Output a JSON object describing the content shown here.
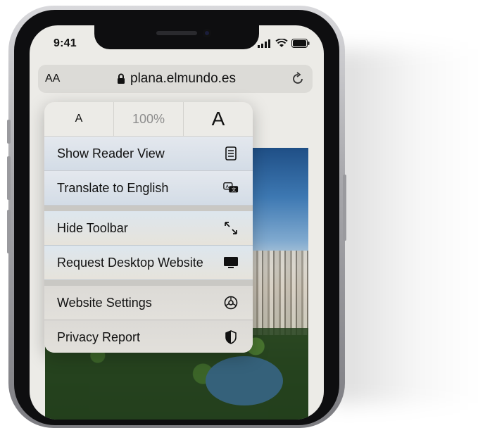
{
  "status_bar": {
    "time": "9:41"
  },
  "address_bar": {
    "text_size_icon": "AA",
    "lock_icon": "lock-icon",
    "url": "plana.elmundo.es",
    "reload_icon": "reload-icon"
  },
  "page_menu": {
    "zoom": {
      "small_a": "A",
      "level": "100%",
      "large_a": "A"
    },
    "items": [
      {
        "label": "Show Reader View",
        "icon": "reader-view-icon"
      },
      {
        "label": "Translate to English",
        "icon": "translate-icon"
      },
      {
        "label": "Hide Toolbar",
        "icon": "hide-toolbar-icon"
      },
      {
        "label": "Request Desktop Website",
        "icon": "desktop-icon"
      },
      {
        "label": "Website Settings",
        "icon": "gear-icon"
      },
      {
        "label": "Privacy Report",
        "icon": "shield-icon"
      }
    ]
  }
}
